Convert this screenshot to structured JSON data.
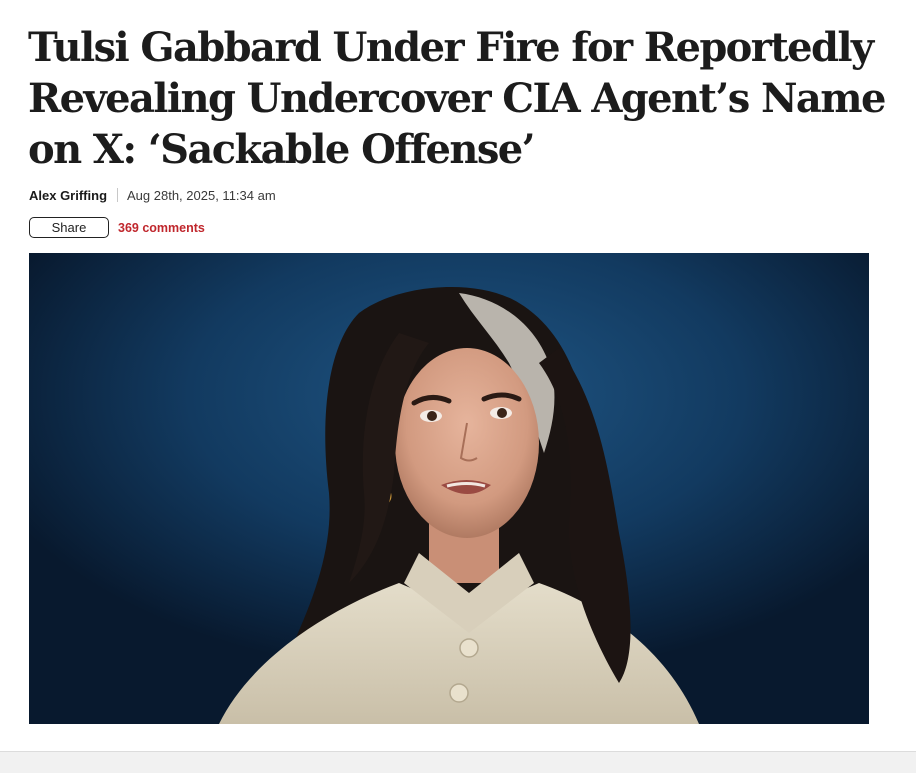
{
  "article": {
    "headline": "Tulsi Gabbard Under Fire for Reportedly Revealing Undercover CIA Agent’s Name on X: ‘Sackable Offense’",
    "author": "Alex Griffing",
    "date": "Aug 28th, 2025, 11:34 am",
    "share_label": "Share",
    "comments_label": "369 comments"
  },
  "colors": {
    "comments_accent": "#c0272d",
    "headline_text": "#1c1c1c",
    "hero_background": "#123a5e"
  }
}
